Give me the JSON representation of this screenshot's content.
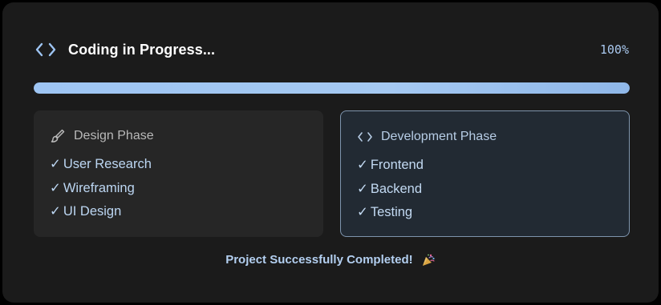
{
  "header": {
    "title": "Coding in Progress...",
    "percent_label": "100%",
    "code_icon": "code-brackets-icon"
  },
  "progress": {
    "value": 1.0,
    "fill_color": "#a5c9f2"
  },
  "phases": [
    {
      "title": "Design Phase",
      "icon": "paintbrush-icon",
      "items": [
        "User Research",
        "Wireframing",
        "UI Design"
      ]
    },
    {
      "title": "Development Phase",
      "icon": "code-brackets-icon",
      "items": [
        "Frontend",
        "Backend",
        "Testing"
      ]
    }
  ],
  "check_mark": "✓",
  "footer": {
    "message": "Project Successfully Completed!",
    "icon": "party-popper-icon"
  },
  "colors": {
    "card_background": "#1b1b1b",
    "accent": "#a5c9f2"
  }
}
